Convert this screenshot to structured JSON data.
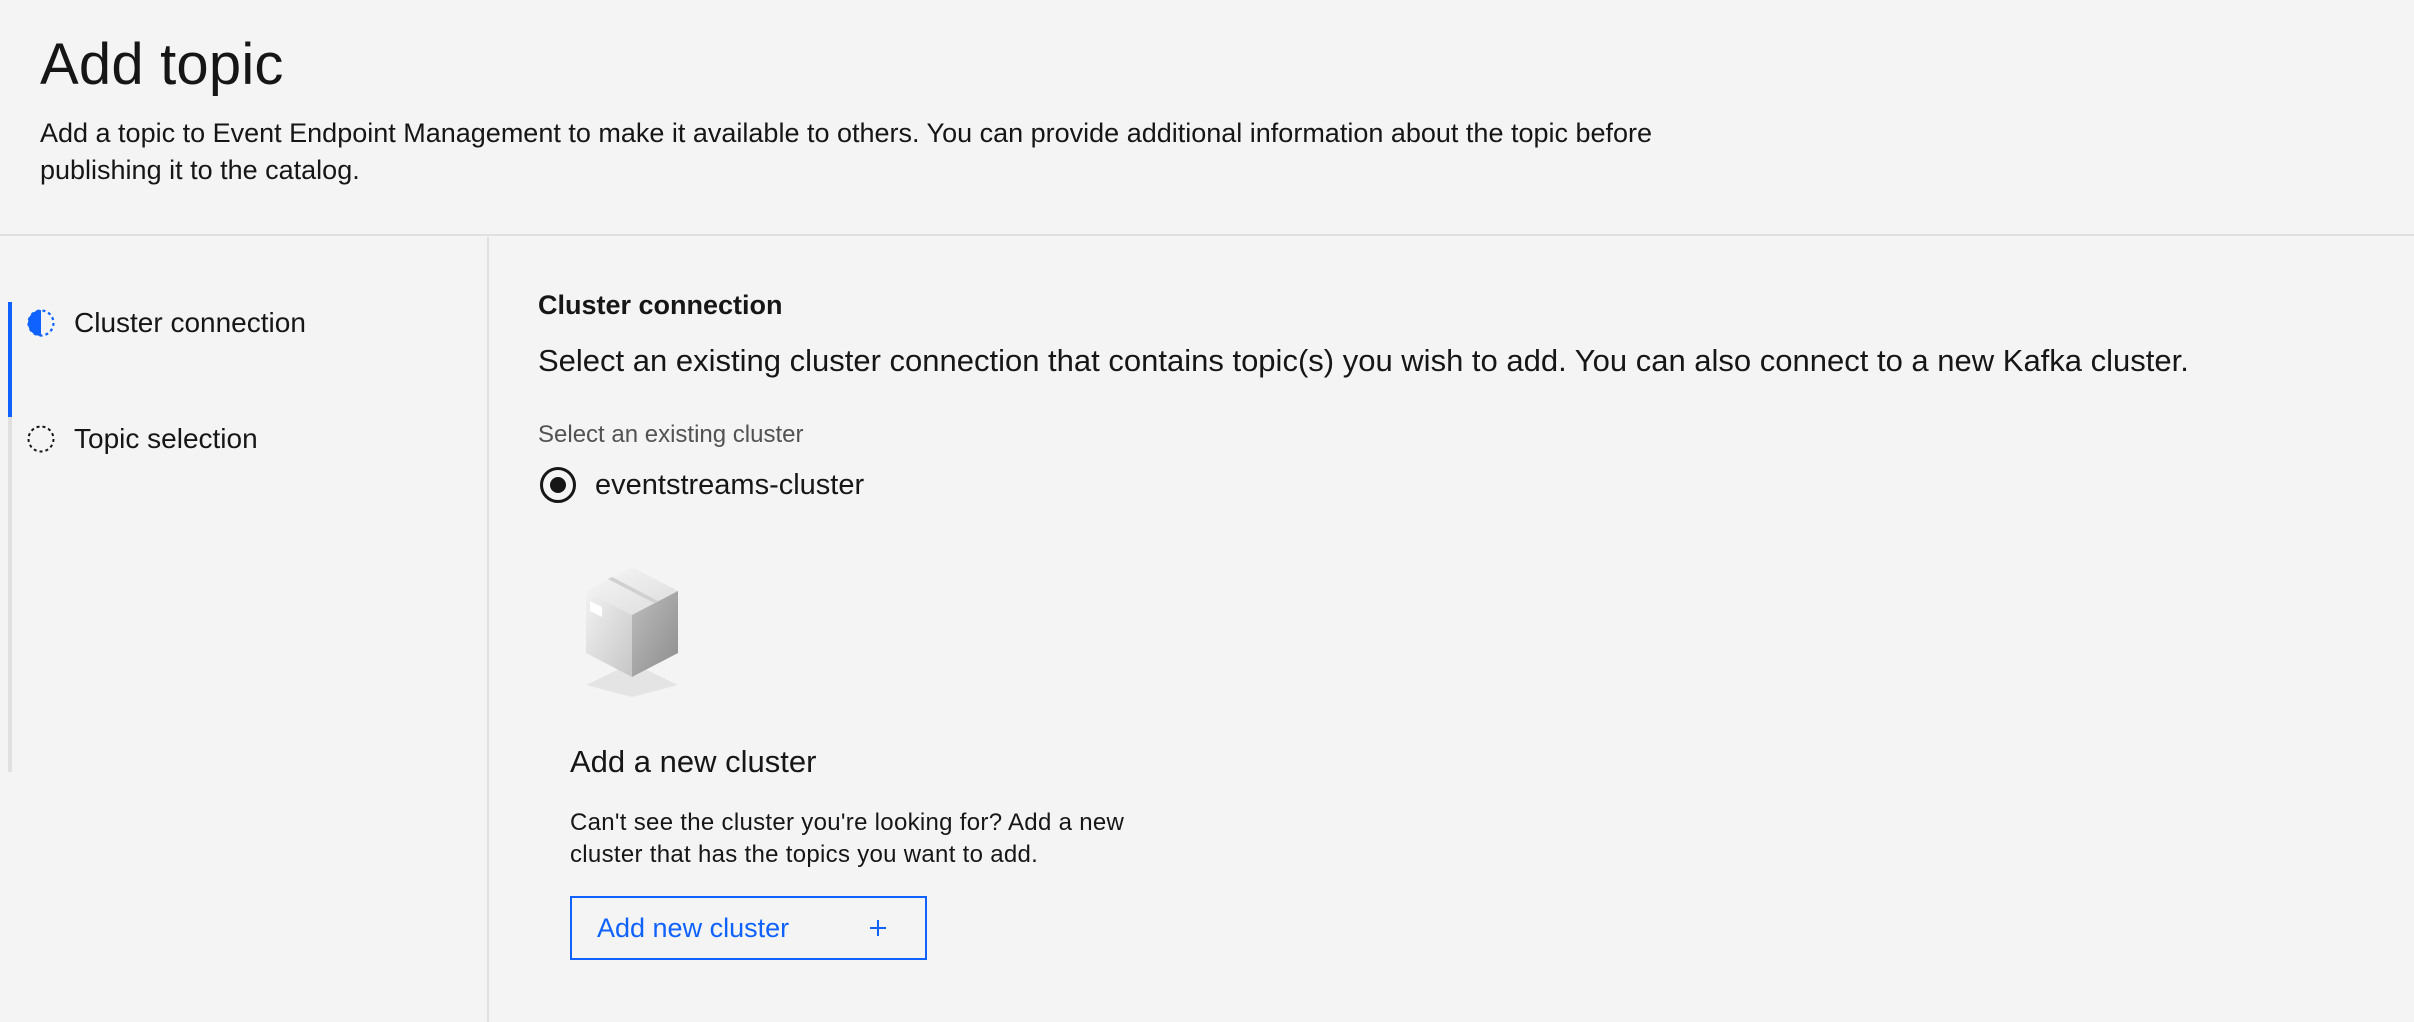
{
  "header": {
    "title": "Add topic",
    "description": "Add a topic to Event Endpoint Management to make it available to others. You can provide additional information about the topic before publishing it to the catalog."
  },
  "progress": {
    "steps": [
      {
        "label": "Cluster connection",
        "state": "current",
        "icon": "half-filled-circle-icon"
      },
      {
        "label": "Topic selection",
        "state": "incomplete",
        "icon": "dashed-circle-icon"
      }
    ]
  },
  "main": {
    "heading": "Cluster connection",
    "description": "Select an existing cluster connection that contains topic(s) you wish to add. You can also connect to a new Kafka cluster.",
    "cluster_field_label": "Select an existing cluster",
    "clusters": [
      {
        "label": "eventstreams-cluster",
        "selected": true
      }
    ],
    "empty_state": {
      "illustration": "box-icon",
      "title": "Add a new cluster",
      "description": "Can't see the cluster you're looking for? Add a new cluster that has the topics you want to add.",
      "button_label": "Add new cluster",
      "button_icon": "plus-icon"
    }
  },
  "colors": {
    "accent": "#0f62fe",
    "background": "#f4f4f4",
    "text": "#161616",
    "secondary_text": "#525252",
    "divider": "#e0e0e0"
  }
}
